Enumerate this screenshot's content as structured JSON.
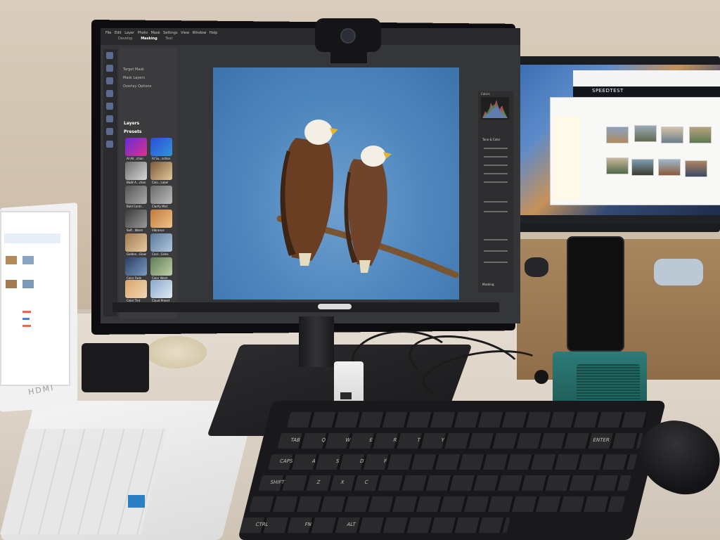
{
  "scene": {
    "description_type": "photo",
    "accent_colors": {
      "sky_blue": "#4d86bd",
      "monitor_black": "#0d0d0f",
      "desk": "#e1d7cb",
      "phone_stand_teal": "#2d7b77"
    }
  },
  "main_monitor": {
    "app": {
      "menu": "File  Edit  Layer  Photo  Mask  Settings  View  Window  Help",
      "tabs": [
        "Develop",
        "Masking",
        "Text"
      ],
      "active_tab": "Masking",
      "panel_header": "Target Mask",
      "panel_items": [
        "Mask Layers",
        "Overlay Options"
      ],
      "layers_label": "Layers",
      "presets_label": "Presets",
      "presets": [
        "AI All...ction",
        "AI Su...ection",
        "B&W A...ction",
        "Colo...Label",
        "Bold Contr...",
        "Clarify Mist",
        "Soft...Warm",
        "Vibrance",
        "Golden...Glow",
        "Cool...Celes",
        "Color Fade",
        "Color Wash",
        "Color Tint",
        "Cloud Preset"
      ],
      "right_panel_heading": "Colors",
      "right_panel_sections": [
        "Tone & Color",
        "Masking"
      ]
    },
    "photo": {
      "subject": "Two bald eagles on a branch",
      "bird_count": 2
    },
    "taskbar": {
      "search_placeholder": ""
    }
  },
  "right_monitor": {
    "browser_header": "SPEEDTEST",
    "window": "File Explorer"
  },
  "laptop": {
    "brand": "HDMI"
  },
  "keyboard": {
    "key_labels": [
      "TAB",
      "CAPS",
      "SHIFT",
      "CTRL",
      "FN",
      "ALT",
      "ENTER",
      "Q",
      "W",
      "E",
      "R",
      "T",
      "Y",
      "A",
      "S",
      "D",
      "F",
      "Z",
      "X",
      "C"
    ]
  },
  "icons": [
    "webcam-icon",
    "usb-hub-icon",
    "phone-icon",
    "mouse-icon"
  ]
}
